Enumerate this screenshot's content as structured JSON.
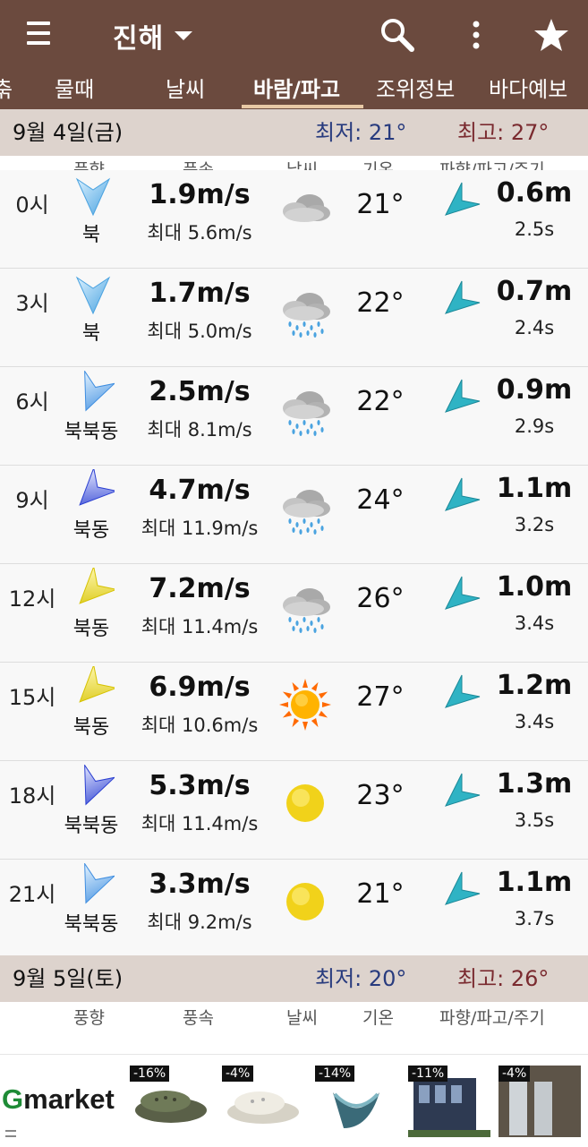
{
  "app": {
    "location_title": "진해",
    "colors": {
      "bar": "#6b4a3e",
      "day_header": "#ddd3cd",
      "min_temp": "#283b7e",
      "max_temp": "#7a2a2f"
    },
    "icons": [
      "menu-icon",
      "chevron-down-icon",
      "search-icon",
      "more-vert-icon",
      "star-icon"
    ]
  },
  "tabs": [
    {
      "label": "춖"
    },
    {
      "label": "물때"
    },
    {
      "label": "날씨"
    },
    {
      "label": "바람/파고",
      "active": true
    },
    {
      "label": "조위정보"
    },
    {
      "label": "바다예보"
    }
  ],
  "columns": {
    "wind_dir": "풍향",
    "wind_speed": "풍속",
    "weather": "날씨",
    "temp": "기온",
    "wave": "파향/파고/주기"
  },
  "days": [
    {
      "date": "9월 4일(금)",
      "min_temp": "최저: 21°",
      "max_temp": "최고: 27°",
      "rows": [
        {
          "time": "0시",
          "dir": "북",
          "speed": "1.9m/s",
          "gust": "최대 5.6m/s",
          "weather": "cloudy",
          "temp": "21°",
          "wave_height": "0.6m",
          "wave_period": "2.5s"
        },
        {
          "time": "3시",
          "dir": "북",
          "speed": "1.7m/s",
          "gust": "최대 5.0m/s",
          "weather": "rain",
          "temp": "22°",
          "wave_height": "0.7m",
          "wave_period": "2.4s"
        },
        {
          "time": "6시",
          "dir": "북북동",
          "speed": "2.5m/s",
          "gust": "최대 8.1m/s",
          "weather": "rain",
          "temp": "22°",
          "wave_height": "0.9m",
          "wave_period": "2.9s"
        },
        {
          "time": "9시",
          "dir": "북동",
          "speed": "4.7m/s",
          "gust": "최대 11.9m/s",
          "weather": "rain",
          "temp": "24°",
          "wave_height": "1.1m",
          "wave_period": "3.2s"
        },
        {
          "time": "12시",
          "dir": "북동",
          "speed": "7.2m/s",
          "gust": "최대 11.4m/s",
          "weather": "rain",
          "temp": "26°",
          "wave_height": "1.0m",
          "wave_period": "3.4s"
        },
        {
          "time": "15시",
          "dir": "북동",
          "speed": "6.9m/s",
          "gust": "최대 10.6m/s",
          "weather": "sunny",
          "temp": "27°",
          "wave_height": "1.2m",
          "wave_period": "3.4s"
        },
        {
          "time": "18시",
          "dir": "북북동",
          "speed": "5.3m/s",
          "gust": "최대 11.4m/s",
          "weather": "clear-night",
          "temp": "23°",
          "wave_height": "1.3m",
          "wave_period": "3.5s"
        },
        {
          "time": "21시",
          "dir": "북북동",
          "speed": "3.3m/s",
          "gust": "최대 9.2m/s",
          "weather": "clear-night",
          "temp": "21°",
          "wave_height": "1.1m",
          "wave_period": "3.7s"
        }
      ]
    },
    {
      "date": "9월 5일(토)",
      "min_temp": "최저: 20°",
      "max_temp": "최고: 26°",
      "rows": []
    }
  ],
  "ad": {
    "brand_g": "G",
    "brand_rest": "market",
    "items": [
      {
        "discount": "-16%",
        "product": "clog-shoe"
      },
      {
        "discount": "-4%",
        "product": "white-clog"
      },
      {
        "discount": "-14%",
        "product": "cooling-scarf"
      },
      {
        "discount": "-11%",
        "product": "container-house"
      },
      {
        "discount": "-4%",
        "product": "rain-gutter"
      }
    ]
  }
}
